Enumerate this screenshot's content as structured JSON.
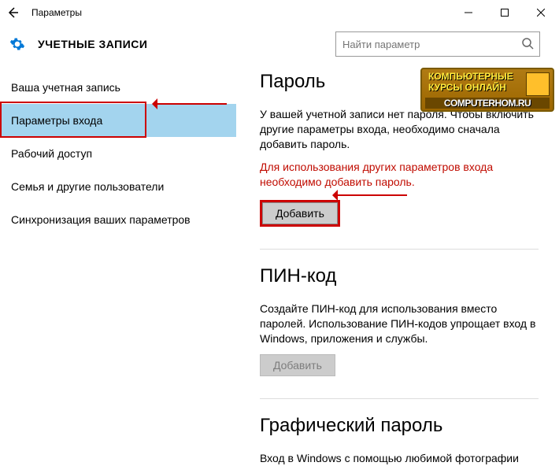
{
  "window": {
    "title": "Параметры"
  },
  "header": {
    "page_title": "УЧЕТНЫЕ ЗАПИСИ",
    "search_placeholder": "Найти параметр"
  },
  "sidebar": {
    "items": [
      {
        "label": "Ваша учетная запись"
      },
      {
        "label": "Параметры входа",
        "selected": true
      },
      {
        "label": "Рабочий доступ"
      },
      {
        "label": "Семья и другие пользователи"
      },
      {
        "label": "Синхронизация ваших параметров"
      }
    ]
  },
  "sections": {
    "password": {
      "title": "Пароль",
      "desc": "У вашей учетной записи нет пароля. Чтобы включить другие параметры входа, необходимо сначала добавить пароль.",
      "warn": "Для использования других параметров входа необходимо добавить пароль.",
      "button": "Добавить"
    },
    "pin": {
      "title": "ПИН-код",
      "desc": "Создайте ПИН-код для использования вместо паролей. Использование ПИН-кодов упрощает вход в Windows, приложения и службы.",
      "button": "Добавить"
    },
    "picture": {
      "title": "Графический пароль",
      "desc": "Вход в Windows с помощью любимой фотографии"
    }
  },
  "badge": {
    "line1": "КОМПЬЮТЕРНЫЕ",
    "line2": "КУРСЫ  ОНЛАЙН",
    "url": "COMPUTERHOM.RU"
  }
}
